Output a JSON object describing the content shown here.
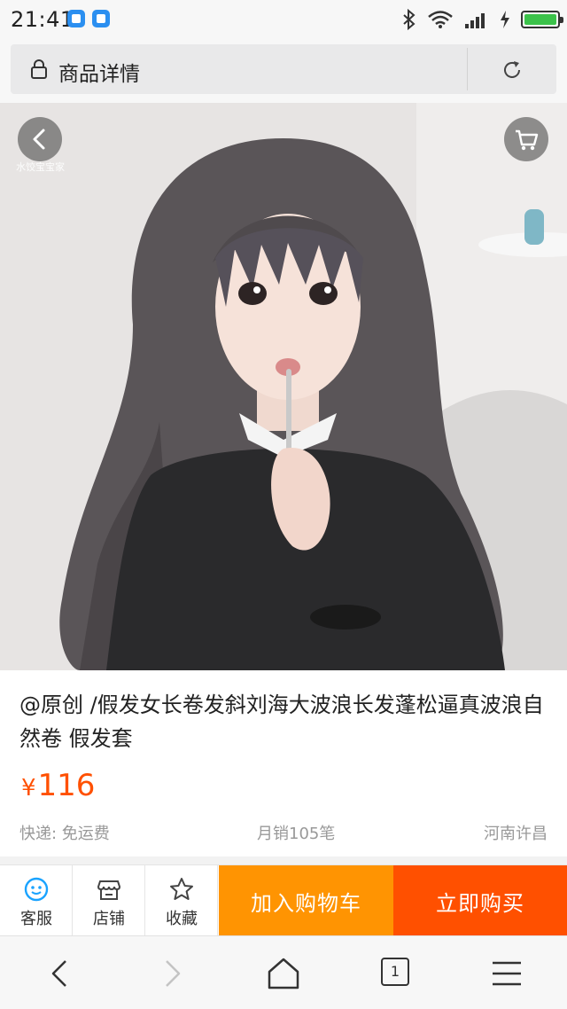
{
  "status_bar": {
    "time": "21:41",
    "icons": [
      "app-icon",
      "app-icon",
      "bluetooth-icon",
      "wifi-icon",
      "signal-icon",
      "charging-icon",
      "battery-icon"
    ]
  },
  "address_bar": {
    "title": "商品详情",
    "icons": [
      "lock-icon",
      "refresh-icon"
    ]
  },
  "product_image": {
    "watermark_text": "水饺宝宝家",
    "overlay_icons": [
      "back-arrow-icon",
      "cart-icon"
    ]
  },
  "product": {
    "title": "@原创 /假发女长卷发斜刘海大波浪长发蓬松逼真波浪自然卷 假发套",
    "currency": "¥",
    "price": "116",
    "shipping": "快递: 免运费",
    "monthly_sales": "月销105笔",
    "location": "河南许昌"
  },
  "action_bar": {
    "customer_service": "客服",
    "shop": "店铺",
    "favorite": "收藏",
    "add_to_cart": "加入购物车",
    "buy_now": "立即购买"
  },
  "nav_bar": {
    "tab_count": "1",
    "icons": [
      "back-icon",
      "forward-icon",
      "home-icon",
      "tabs-icon",
      "menu-icon"
    ]
  },
  "colors": {
    "price": "#ff5000",
    "add_to_cart_bg": "#ff9402",
    "buy_now_bg": "#ff5000",
    "battery": "#3bc24a",
    "service_icon": "#1aa3ff"
  }
}
